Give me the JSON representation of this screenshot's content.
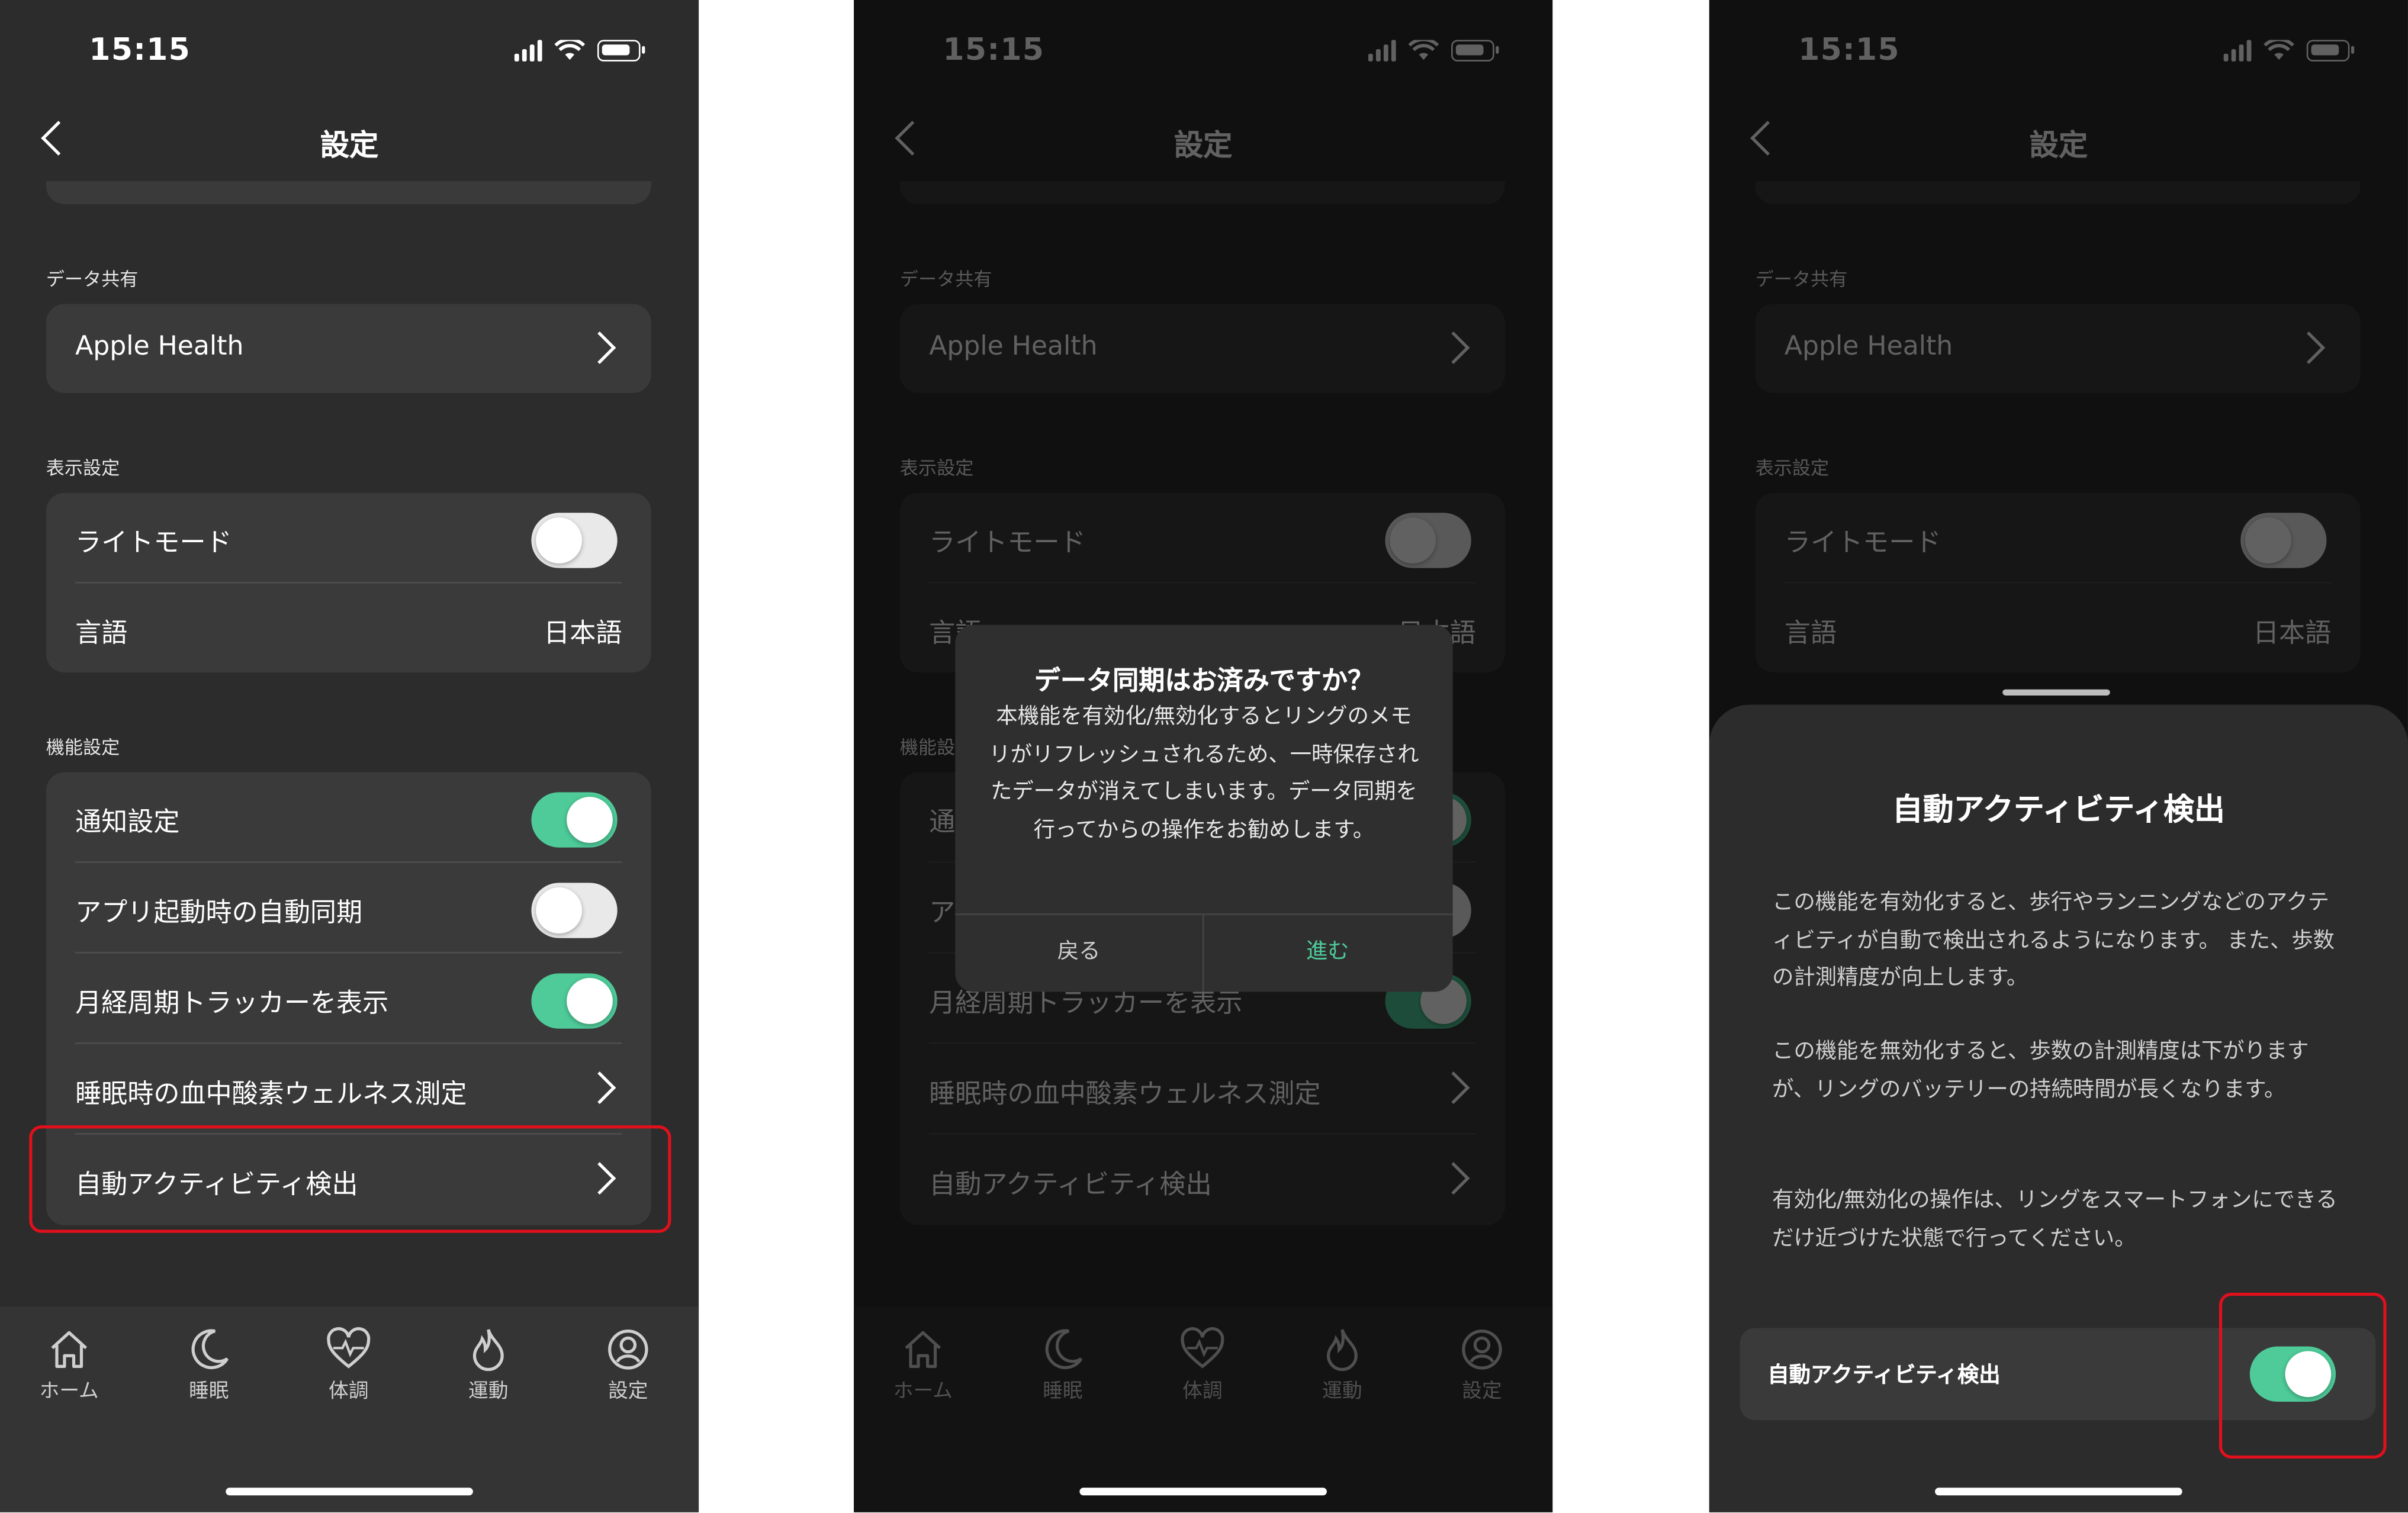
{
  "colors": {
    "accent_green": "#4ecb99",
    "highlight_red": "#e0101c",
    "background": "#2c2c2c",
    "card": "#3a3a3a"
  },
  "status": {
    "time": "15:15"
  },
  "screen1": {
    "title": "設定",
    "section_data_share": "データ共有",
    "apple_health": "Apple Health",
    "section_display": "表示設定",
    "light_mode": "ライトモード",
    "language": "言語",
    "language_value": "日本語",
    "section_features": "機能設定",
    "notify": "通知設定",
    "auto_sync": "アプリ起動時の自動同期",
    "cycle_tracker": "月経周期トラッカーを表示",
    "spo2": "睡眠時の血中酸素ウェルネス測定",
    "auto_activity": "自動アクティビティ検出",
    "toggles": {
      "light_mode": false,
      "notify": true,
      "auto_sync": false,
      "cycle_tracker": true
    }
  },
  "tabbar": {
    "home": "ホーム",
    "sleep": "睡眠",
    "condition": "体調",
    "exercise": "運動",
    "settings": "設定"
  },
  "dialog": {
    "title": "データ同期はお済みですか？",
    "body": "本機能を有効化/無効化するとリングのメモリがリフレッシュされるため、一時保存されたデータが消えてしまいます。データ同期を行ってからの操作をお勧めします。",
    "back": "戻る",
    "next": "進む"
  },
  "sheet": {
    "title": "自動アクティビティ検出",
    "para1": "この機能を有効化すると、歩行やランニングなどのアクティビティが自動で検出されるようになります。 また、歩数の計測精度が向上します。",
    "para2": "この機能を無効化すると、歩数の計測精度は下がりますが、リングのバッテリーの持続時間が長くなります。",
    "para3": "有効化/無効化の操作は、リングをスマートフォンにできるだけ近づけた状態で行ってください。",
    "option_label": "自動アクティビティ検出",
    "option_on": true
  }
}
